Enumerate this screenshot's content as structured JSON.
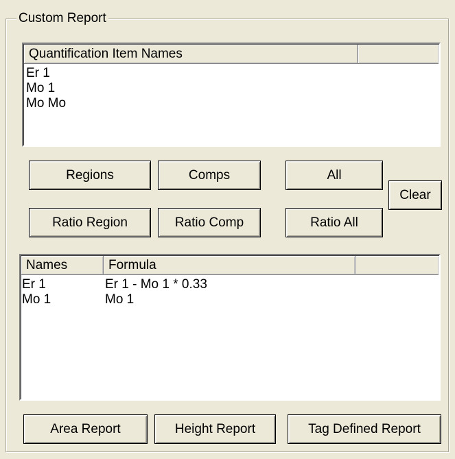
{
  "group": {
    "title": "Custom Report"
  },
  "items_list": {
    "headers": [
      "Quantification Item Names",
      ""
    ],
    "rows": [
      "Er 1",
      "Mo 1",
      "Mo Mo"
    ]
  },
  "buttons": {
    "regions": "Regions",
    "comps": "Comps",
    "all": "All",
    "clear": "Clear",
    "ratio_region": "Ratio Region",
    "ratio_comp": "Ratio Comp",
    "ratio_all": "Ratio All",
    "area_report": "Area Report",
    "height_report": "Height Report",
    "tag_defined_report": "Tag Defined Report"
  },
  "formula_list": {
    "headers": [
      "Names",
      "Formula",
      ""
    ],
    "rows": [
      {
        "name": "Er 1",
        "formula": "Er 1 - Mo 1 * 0.33"
      },
      {
        "name": "Mo 1",
        "formula": "Mo 1"
      }
    ]
  }
}
